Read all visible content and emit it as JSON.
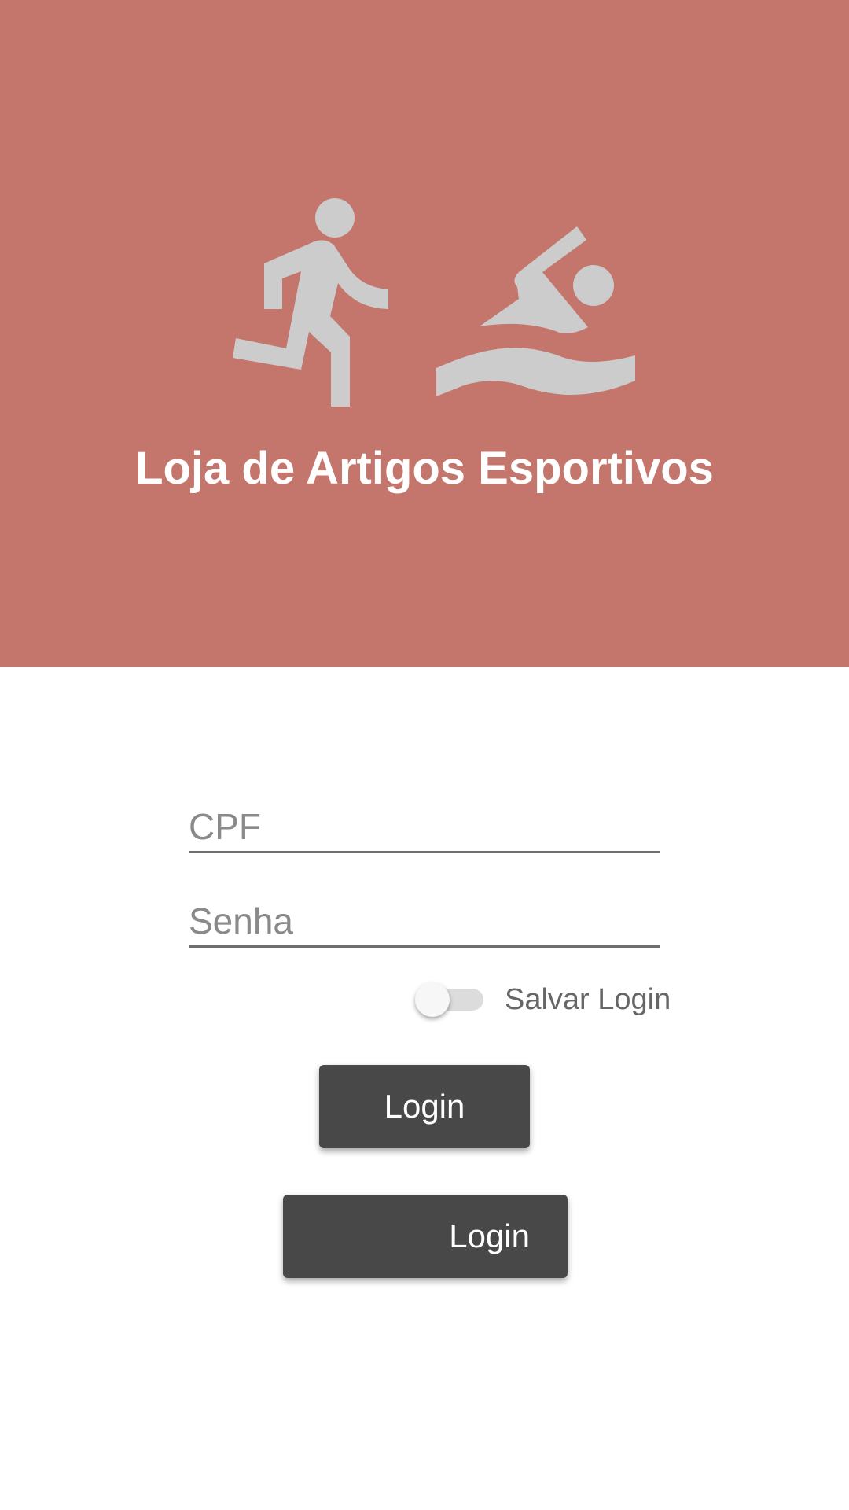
{
  "header": {
    "title": "Loja de Artigos Esportivos",
    "background_color": "#c4766c",
    "icons": [
      "directions-run-icon",
      "pool-swimmer-icon"
    ],
    "icon_color": "#cccccc"
  },
  "form": {
    "cpf_placeholder": "CPF",
    "cpf_value": "",
    "senha_placeholder": "Senha",
    "senha_value": "",
    "save_login_label": "Salvar Login",
    "save_login_enabled": false
  },
  "buttons": {
    "login_primary_label": "Login",
    "login_secondary_label": "Login",
    "button_color": "#484848"
  }
}
